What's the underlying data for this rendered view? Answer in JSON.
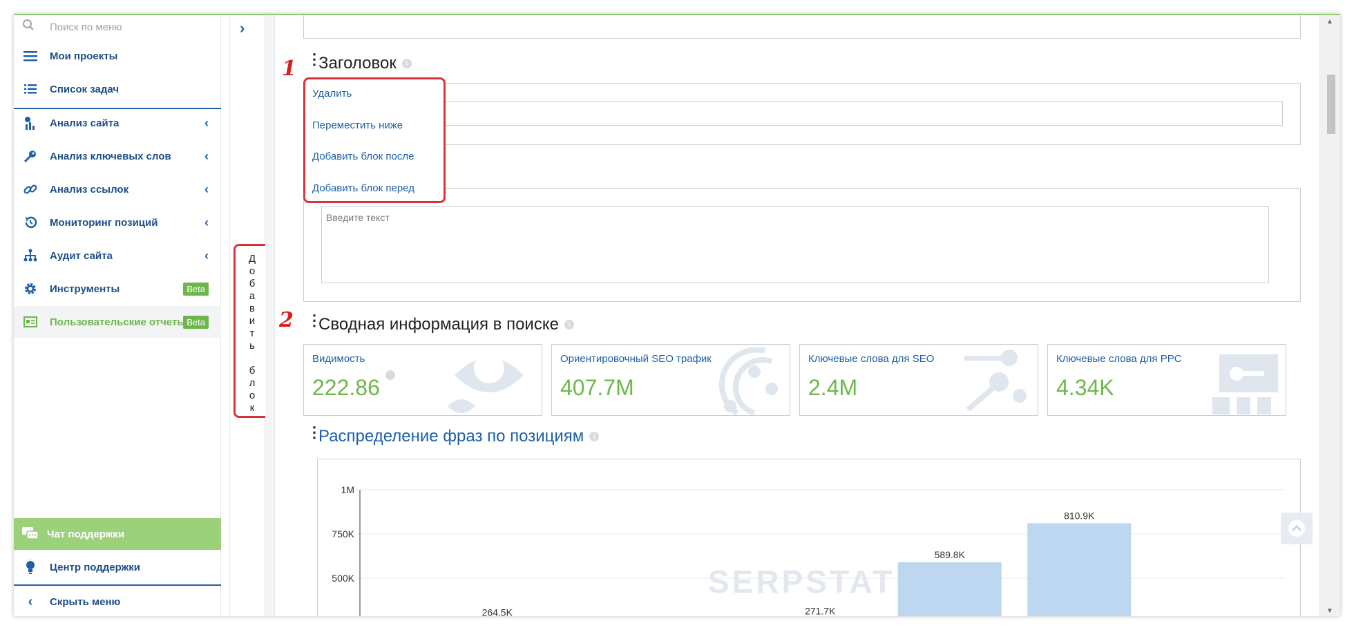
{
  "sidebar": {
    "search_placeholder": "Поиск по меню",
    "items": [
      {
        "label": "Мои проекты",
        "icon": "list-icon"
      },
      {
        "label": "Список задач",
        "icon": "tasks-icon"
      },
      {
        "label": "Анализ сайта",
        "icon": "chart-icon"
      },
      {
        "label": "Анализ ключевых слов",
        "icon": "key-icon"
      },
      {
        "label": "Анализ ссылок",
        "icon": "link-icon"
      },
      {
        "label": "Мониторинг позиций",
        "icon": "history-icon"
      },
      {
        "label": "Аудит сайта",
        "icon": "hierarchy-icon"
      },
      {
        "label": "Инструменты",
        "icon": "gear-icon",
        "badge": "Beta"
      },
      {
        "label": "Пользовательские отчеты",
        "icon": "report-icon",
        "badge": "Beta"
      }
    ],
    "chat_label": "Чат поддержки",
    "support_label": "Центр поддержки",
    "hide_label": "Скрыть меню"
  },
  "add_block": {
    "letters": [
      "Д",
      "о",
      "б",
      "а",
      "в",
      "и",
      "т",
      "ь",
      " ",
      "б",
      "л",
      "о",
      "к"
    ]
  },
  "markers": {
    "one": "1",
    "two": "2"
  },
  "header_section": {
    "title": "Заголовок",
    "menu": [
      "Удалить",
      "Переместить ниже",
      "Добавить блок после",
      "Добавить блок перед"
    ],
    "text_placeholder": "Введите текст"
  },
  "summary": {
    "title": "Сводная информация в поиске",
    "cards": [
      {
        "title": "Видимость",
        "value": "222.86"
      },
      {
        "title": "Ориентировочный SEO трафик",
        "value": "407.7M"
      },
      {
        "title": "Ключевые слова для SEO",
        "value": "2.4M"
      },
      {
        "title": "Ключевые слова для PPC",
        "value": "4.34K"
      }
    ]
  },
  "distribution": {
    "title": "Распределение фраз по позициям",
    "watermark": "SERPSTAT"
  },
  "chart_data": {
    "type": "bar",
    "title": "Распределение фраз по позициям",
    "y_ticks": [
      "1M",
      "750K",
      "500K"
    ],
    "ylim": [
      0,
      1000000
    ],
    "values": [
      264500,
      271700,
      589800,
      810900
    ],
    "data_labels": [
      "264.5K",
      "271.7K",
      "589.8K",
      "810.9K"
    ]
  },
  "colors": {
    "accent": "#1d5fa8",
    "green": "#6db74a",
    "highlight": "#d9343a",
    "bar": "#bcd7ef"
  }
}
